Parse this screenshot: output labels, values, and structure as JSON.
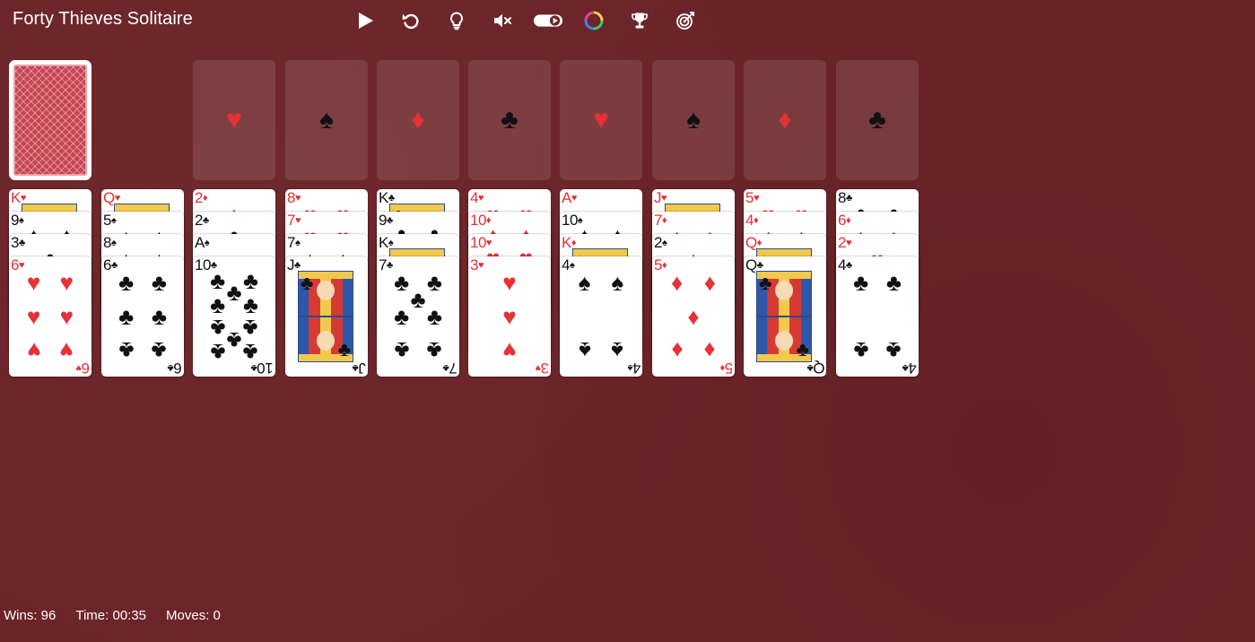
{
  "app": {
    "title": "Forty Thieves Solitaire"
  },
  "toolbar": {
    "buttons": [
      {
        "name": "play-button",
        "icon": "play-icon"
      },
      {
        "name": "undo-button",
        "icon": "undo-icon"
      },
      {
        "name": "hint-button",
        "icon": "lightbulb-icon"
      },
      {
        "name": "sound-button",
        "icon": "mute-icon"
      },
      {
        "name": "autoplay-toggle",
        "icon": "toggle-icon"
      },
      {
        "name": "theme-button",
        "icon": "color-wheel-icon"
      },
      {
        "name": "leaderboard-button",
        "icon": "trophy-icon"
      },
      {
        "name": "challenge-button",
        "icon": "target-icon"
      }
    ]
  },
  "colors": {
    "felt": "#6b2428",
    "red_suit": "#e53137",
    "black_suit": "#111111"
  },
  "stock": {
    "face_down": true
  },
  "foundations": [
    {
      "suit": "♥",
      "color": "red"
    },
    {
      "suit": "♠",
      "color": "black"
    },
    {
      "suit": "♦",
      "color": "red"
    },
    {
      "suit": "♣",
      "color": "black"
    },
    {
      "suit": "♥",
      "color": "red"
    },
    {
      "suit": "♠",
      "color": "black"
    },
    {
      "suit": "♦",
      "color": "red"
    },
    {
      "suit": "♣",
      "color": "black"
    }
  ],
  "tableau": [
    [
      {
        "rank": "K",
        "suit": "♥"
      },
      {
        "rank": "9",
        "suit": "♠"
      },
      {
        "rank": "3",
        "suit": "♣"
      },
      {
        "rank": "6",
        "suit": "♥"
      }
    ],
    [
      {
        "rank": "Q",
        "suit": "♥"
      },
      {
        "rank": "5",
        "suit": "♠"
      },
      {
        "rank": "8",
        "suit": "♠"
      },
      {
        "rank": "6",
        "suit": "♣"
      }
    ],
    [
      {
        "rank": "2",
        "suit": "♦"
      },
      {
        "rank": "2",
        "suit": "♣"
      },
      {
        "rank": "A",
        "suit": "♠"
      },
      {
        "rank": "10",
        "suit": "♣"
      }
    ],
    [
      {
        "rank": "8",
        "suit": "♥"
      },
      {
        "rank": "7",
        "suit": "♥"
      },
      {
        "rank": "7",
        "suit": "♠"
      },
      {
        "rank": "J",
        "suit": "♣"
      }
    ],
    [
      {
        "rank": "K",
        "suit": "♣"
      },
      {
        "rank": "9",
        "suit": "♣"
      },
      {
        "rank": "K",
        "suit": "♠"
      },
      {
        "rank": "7",
        "suit": "♣"
      }
    ],
    [
      {
        "rank": "4",
        "suit": "♥"
      },
      {
        "rank": "10",
        "suit": "♦"
      },
      {
        "rank": "10",
        "suit": "♥"
      },
      {
        "rank": "3",
        "suit": "♥"
      }
    ],
    [
      {
        "rank": "A",
        "suit": "♥"
      },
      {
        "rank": "10",
        "suit": "♠"
      },
      {
        "rank": "K",
        "suit": "♦"
      },
      {
        "rank": "4",
        "suit": "♠"
      }
    ],
    [
      {
        "rank": "J",
        "suit": "♥"
      },
      {
        "rank": "7",
        "suit": "♦"
      },
      {
        "rank": "2",
        "suit": "♠"
      },
      {
        "rank": "5",
        "suit": "♦"
      }
    ],
    [
      {
        "rank": "5",
        "suit": "♥"
      },
      {
        "rank": "4",
        "suit": "♦"
      },
      {
        "rank": "Q",
        "suit": "♦"
      },
      {
        "rank": "Q",
        "suit": "♣"
      }
    ],
    [
      {
        "rank": "8",
        "suit": "♣"
      },
      {
        "rank": "6",
        "suit": "♦"
      },
      {
        "rank": "2",
        "suit": "♥"
      },
      {
        "rank": "4",
        "suit": "♣"
      }
    ]
  ],
  "footer": {
    "wins": "Wins: 96",
    "time": "Time: 00:35",
    "moves": "Moves: 0"
  }
}
